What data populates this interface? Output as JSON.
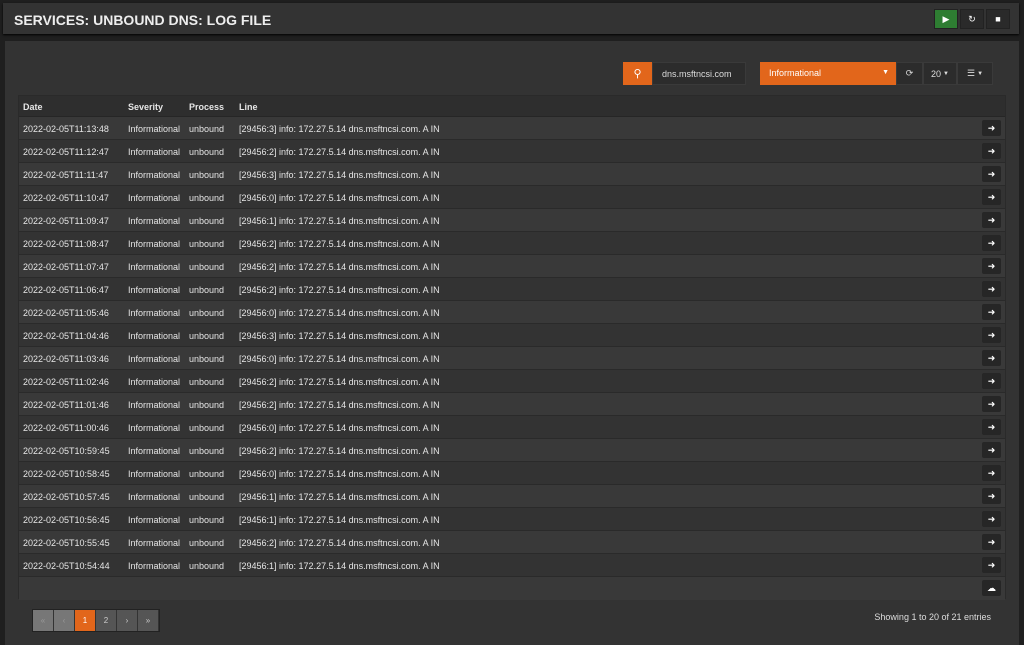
{
  "header": {
    "title": "SERVICES: UNBOUND DNS: LOG FILE",
    "buttons": [
      {
        "icon": "play-icon",
        "glyph": "▶"
      },
      {
        "icon": "restart-icon",
        "glyph": "↻"
      },
      {
        "icon": "stop-icon",
        "glyph": "■"
      }
    ]
  },
  "toolbar": {
    "search_value": "dns.msftncsi.com",
    "severity": "Informational",
    "page_size": "20",
    "accent": "#e2661b"
  },
  "table": {
    "columns": [
      "Date",
      "Severity",
      "Process",
      "Line"
    ],
    "rows": [
      [
        "2022-02-05T11:13:48",
        "Informational",
        "unbound",
        "[29456:3] info: 172.27.5.14 dns.msftncsi.com. A IN"
      ],
      [
        "2022-02-05T11:12:47",
        "Informational",
        "unbound",
        "[29456:2] info: 172.27.5.14 dns.msftncsi.com. A IN"
      ],
      [
        "2022-02-05T11:11:47",
        "Informational",
        "unbound",
        "[29456:3] info: 172.27.5.14 dns.msftncsi.com. A IN"
      ],
      [
        "2022-02-05T11:10:47",
        "Informational",
        "unbound",
        "[29456:0] info: 172.27.5.14 dns.msftncsi.com. A IN"
      ],
      [
        "2022-02-05T11:09:47",
        "Informational",
        "unbound",
        "[29456:1] info: 172.27.5.14 dns.msftncsi.com. A IN"
      ],
      [
        "2022-02-05T11:08:47",
        "Informational",
        "unbound",
        "[29456:2] info: 172.27.5.14 dns.msftncsi.com. A IN"
      ],
      [
        "2022-02-05T11:07:47",
        "Informational",
        "unbound",
        "[29456:2] info: 172.27.5.14 dns.msftncsi.com. A IN"
      ],
      [
        "2022-02-05T11:06:47",
        "Informational",
        "unbound",
        "[29456:2] info: 172.27.5.14 dns.msftncsi.com. A IN"
      ],
      [
        "2022-02-05T11:05:46",
        "Informational",
        "unbound",
        "[29456:0] info: 172.27.5.14 dns.msftncsi.com. A IN"
      ],
      [
        "2022-02-05T11:04:46",
        "Informational",
        "unbound",
        "[29456:3] info: 172.27.5.14 dns.msftncsi.com. A IN"
      ],
      [
        "2022-02-05T11:03:46",
        "Informational",
        "unbound",
        "[29456:0] info: 172.27.5.14 dns.msftncsi.com. A IN"
      ],
      [
        "2022-02-05T11:02:46",
        "Informational",
        "unbound",
        "[29456:2] info: 172.27.5.14 dns.msftncsi.com. A IN"
      ],
      [
        "2022-02-05T11:01:46",
        "Informational",
        "unbound",
        "[29456:2] info: 172.27.5.14 dns.msftncsi.com. A IN"
      ],
      [
        "2022-02-05T11:00:46",
        "Informational",
        "unbound",
        "[29456:0] info: 172.27.5.14 dns.msftncsi.com. A IN"
      ],
      [
        "2022-02-05T10:59:45",
        "Informational",
        "unbound",
        "[29456:2] info: 172.27.5.14 dns.msftncsi.com. A IN"
      ],
      [
        "2022-02-05T10:58:45",
        "Informational",
        "unbound",
        "[29456:0] info: 172.27.5.14 dns.msftncsi.com. A IN"
      ],
      [
        "2022-02-05T10:57:45",
        "Informational",
        "unbound",
        "[29456:1] info: 172.27.5.14 dns.msftncsi.com. A IN"
      ],
      [
        "2022-02-05T10:56:45",
        "Informational",
        "unbound",
        "[29456:1] info: 172.27.5.14 dns.msftncsi.com. A IN"
      ],
      [
        "2022-02-05T10:55:45",
        "Informational",
        "unbound",
        "[29456:2] info: 172.27.5.14 dns.msftncsi.com. A IN"
      ],
      [
        "2022-02-05T10:54:44",
        "Informational",
        "unbound",
        "[29456:1] info: 172.27.5.14 dns.msftncsi.com. A IN"
      ]
    ]
  },
  "pagination": {
    "first": "«",
    "prev": "‹",
    "pages": [
      "1",
      "2"
    ],
    "current": "1",
    "next": "›",
    "last": "»",
    "info": "Showing 1 to 20 of 21 entries"
  }
}
